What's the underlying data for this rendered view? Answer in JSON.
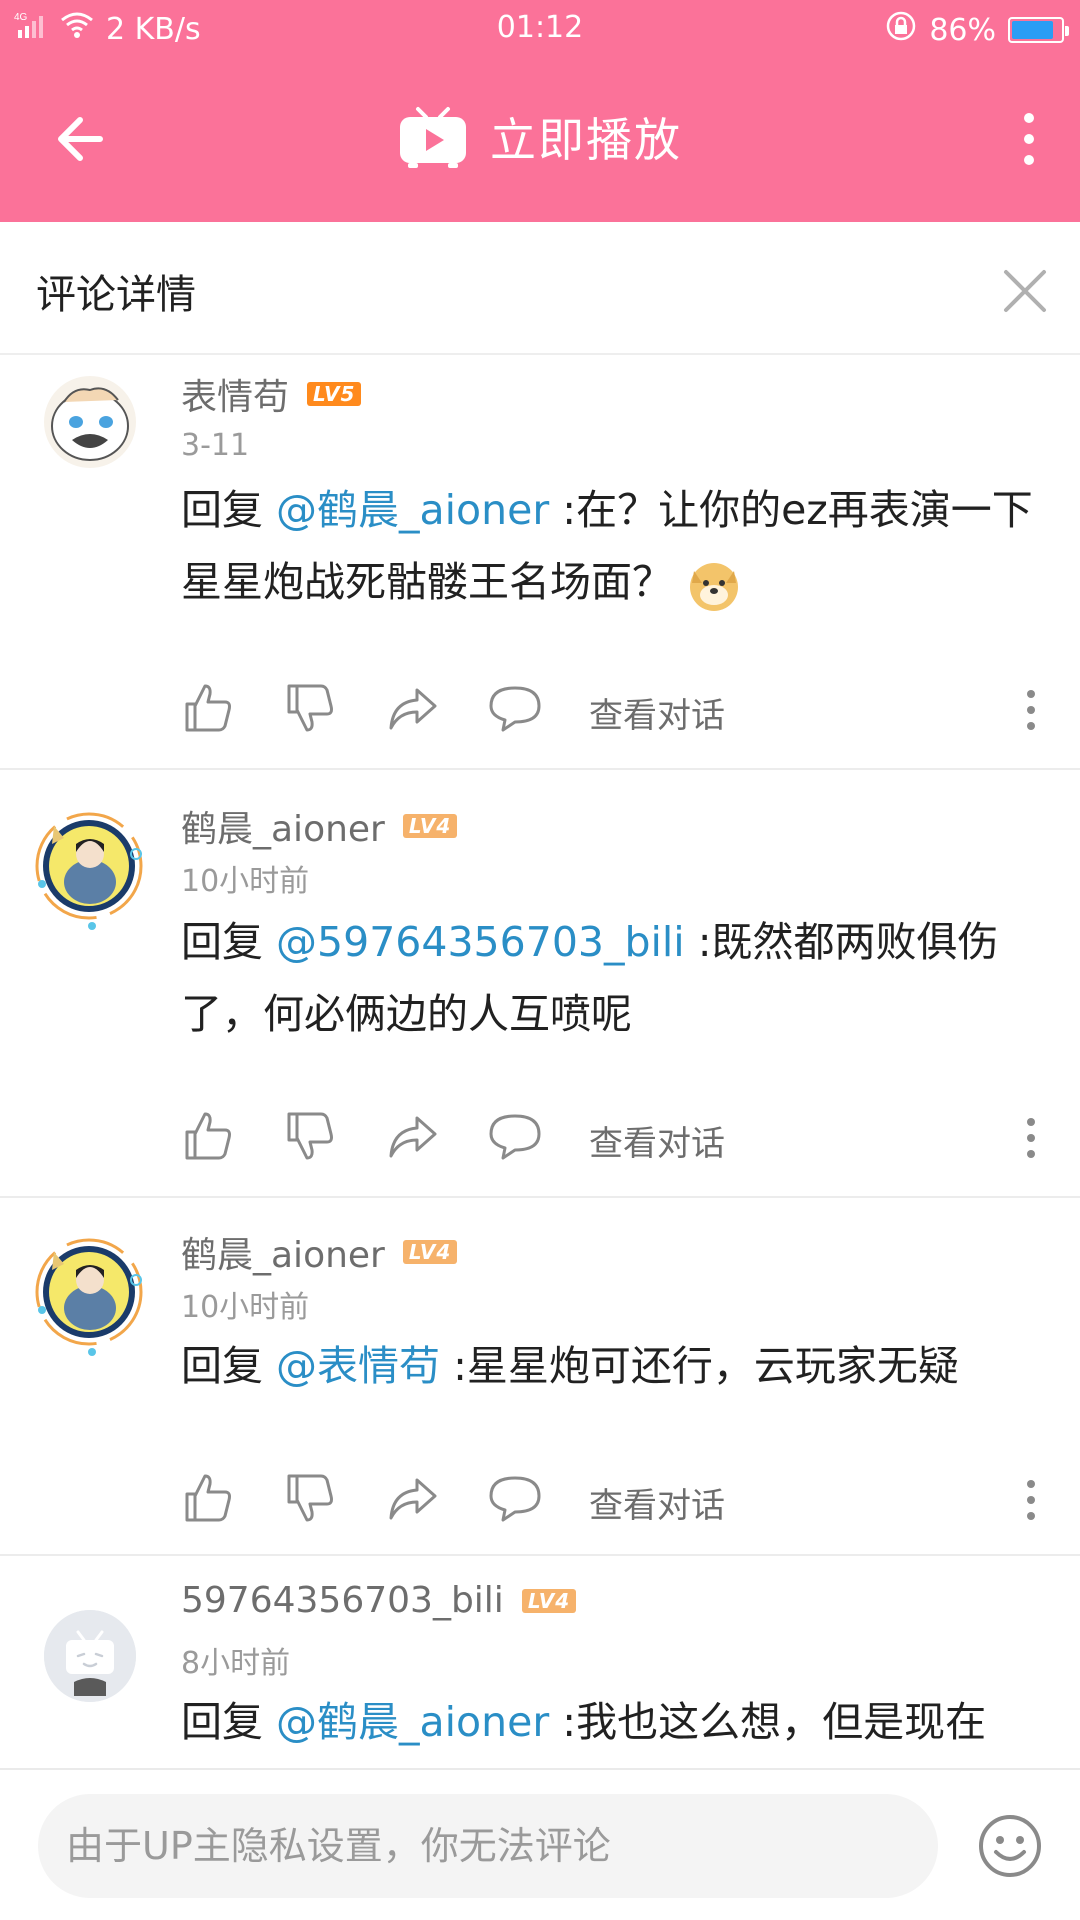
{
  "status_bar": {
    "network": "4G",
    "speed": "2 KB/s",
    "time": "01:12",
    "battery_percent": "86%",
    "battery_level": 0.86
  },
  "app_bar": {
    "title": "立即播放",
    "accent_color": "#fb7299"
  },
  "detail": {
    "title": "评论详情"
  },
  "comments": [
    {
      "username": "表情苟",
      "level": "LV5",
      "level_color": "#ff8a1d",
      "time": "3-11",
      "reply_prefix": "回复 ",
      "mention": "@鹤晨_aioner",
      "body": " :在？让你的ez再表演一下星星炮战死骷髅王名场面？",
      "emoji": "doge-emoji",
      "view_conversation": "查看对话"
    },
    {
      "username": "鹤晨_aioner",
      "level": "LV4",
      "level_color": "#f6b26b",
      "time": "10小时前",
      "reply_prefix": "回复 ",
      "mention": "@59764356703_bili",
      "body": " :既然都两败俱伤了，何必俩边的人互喷呢",
      "view_conversation": "查看对话"
    },
    {
      "username": "鹤晨_aioner",
      "level": "LV4",
      "level_color": "#f6b26b",
      "time": "10小时前",
      "reply_prefix": "回复 ",
      "mention": "@表情苟",
      "body": " :星星炮可还行，云玩家无疑",
      "view_conversation": "查看对话"
    },
    {
      "username": "59764356703_bili",
      "level": "LV4",
      "level_color": "#f6b26b",
      "time": "8小时前",
      "reply_prefix": "回复 ",
      "mention": "@鹤晨_aioner",
      "body": " :我也这么想，但是现在"
    }
  ],
  "bottom_bar": {
    "placeholder": "由于UP主隐私设置，你无法评论"
  }
}
